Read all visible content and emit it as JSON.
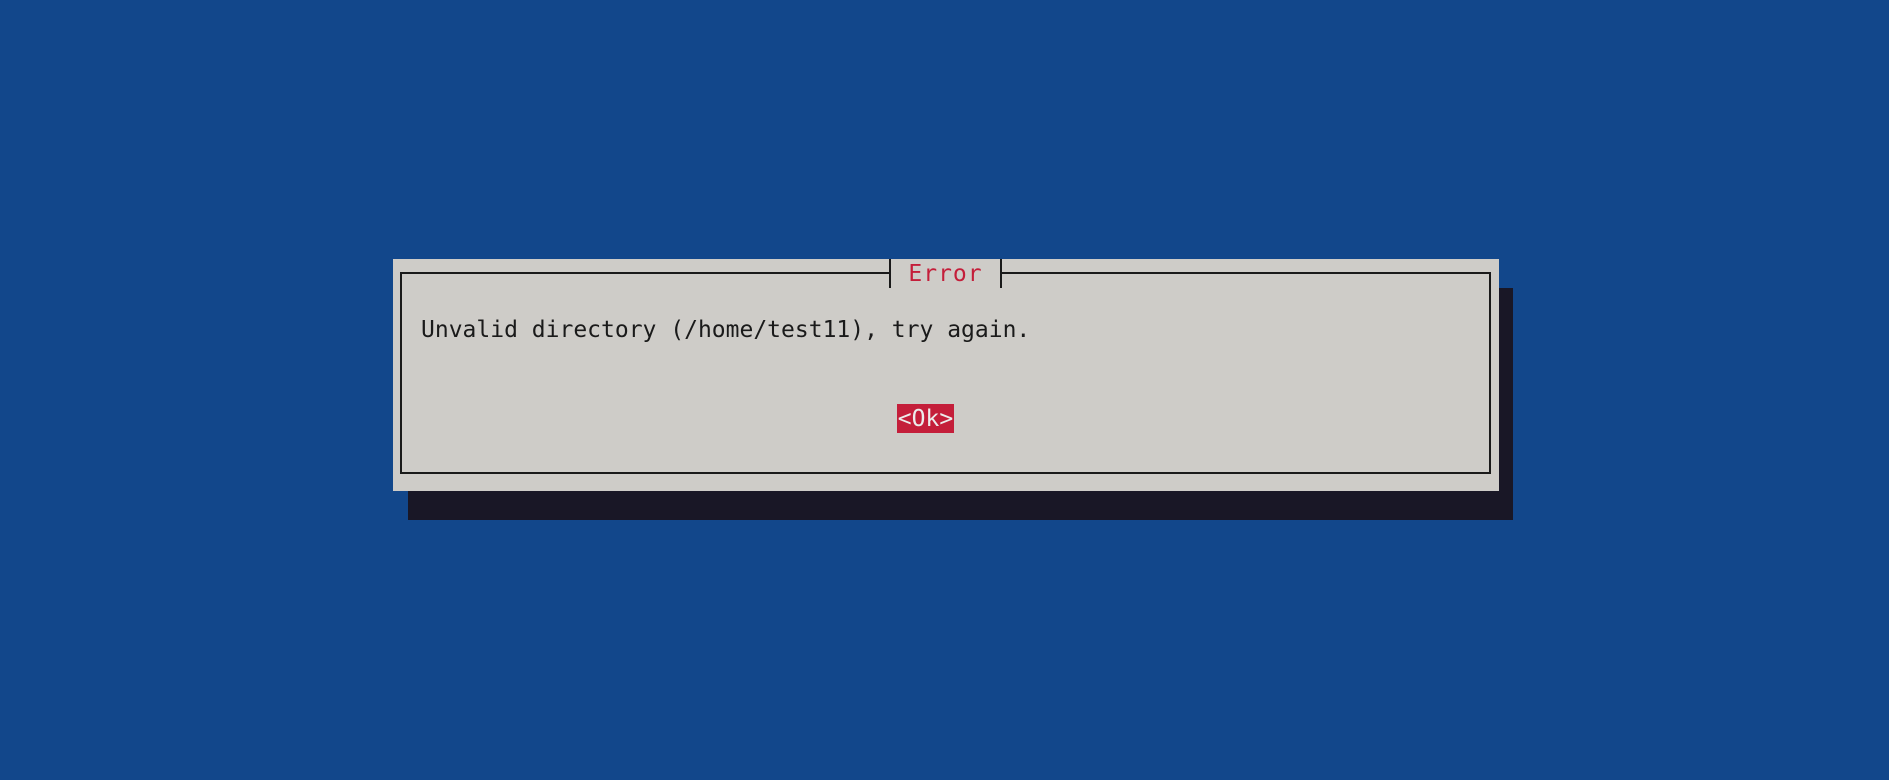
{
  "dialog": {
    "title": "Error",
    "message": "Unvalid directory (/home/test11), try again.",
    "ok_label": "<Ok>"
  },
  "colors": {
    "background": "#12478b",
    "dialog_background": "#ceccc8",
    "shadow": "#191726",
    "title_text": "#c41e3a",
    "button_background": "#c41e3a",
    "button_text": "#ececec",
    "message_text": "#1a1a1a"
  }
}
